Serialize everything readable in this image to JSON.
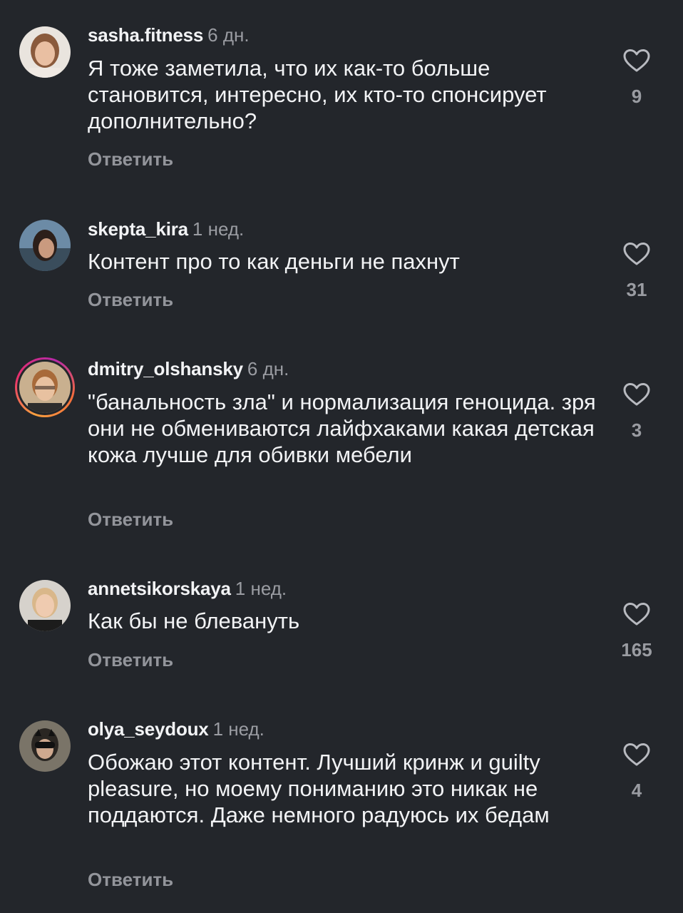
{
  "comments": [
    {
      "username": "sasha.fitness",
      "time": "6 дн.",
      "text": "Я тоже заметила, что их как-то больше становится, интересно, их кто-то спонсирует дополнительно?",
      "reply": "Ответить",
      "likes": "9"
    },
    {
      "username": "skepta_kira",
      "time": "1 нед.",
      "text": "Контент про то как деньги не пахнут",
      "reply": "Ответить",
      "likes": "31"
    },
    {
      "username": "dmitry_olshansky",
      "time": "6 дн.",
      "text": "\"банальность зла\" и нормализация геноцида. зря они не обмениваются лайфхаками какая детская кожа лучше для обивки мебели",
      "reply": "Ответить",
      "likes": "3"
    },
    {
      "username": "annetsikorskaya",
      "time": "1 нед.",
      "text": "Как бы не блевануть",
      "reply": "Ответить",
      "likes": "165"
    },
    {
      "username": "olya_seydoux",
      "time": "1 нед.",
      "text": "Обожаю этот контент. Лучший кринж и guilty pleasure, но моему пониманию это никак не поддаются. Даже немного радуюсь их бедам",
      "reply": "Ответить",
      "likes": "4"
    }
  ],
  "colors": {
    "background": "#23262b",
    "text": "#f2f3f5",
    "muted": "#9a9ca2"
  },
  "icons": {
    "like": "heart-outline-icon"
  }
}
